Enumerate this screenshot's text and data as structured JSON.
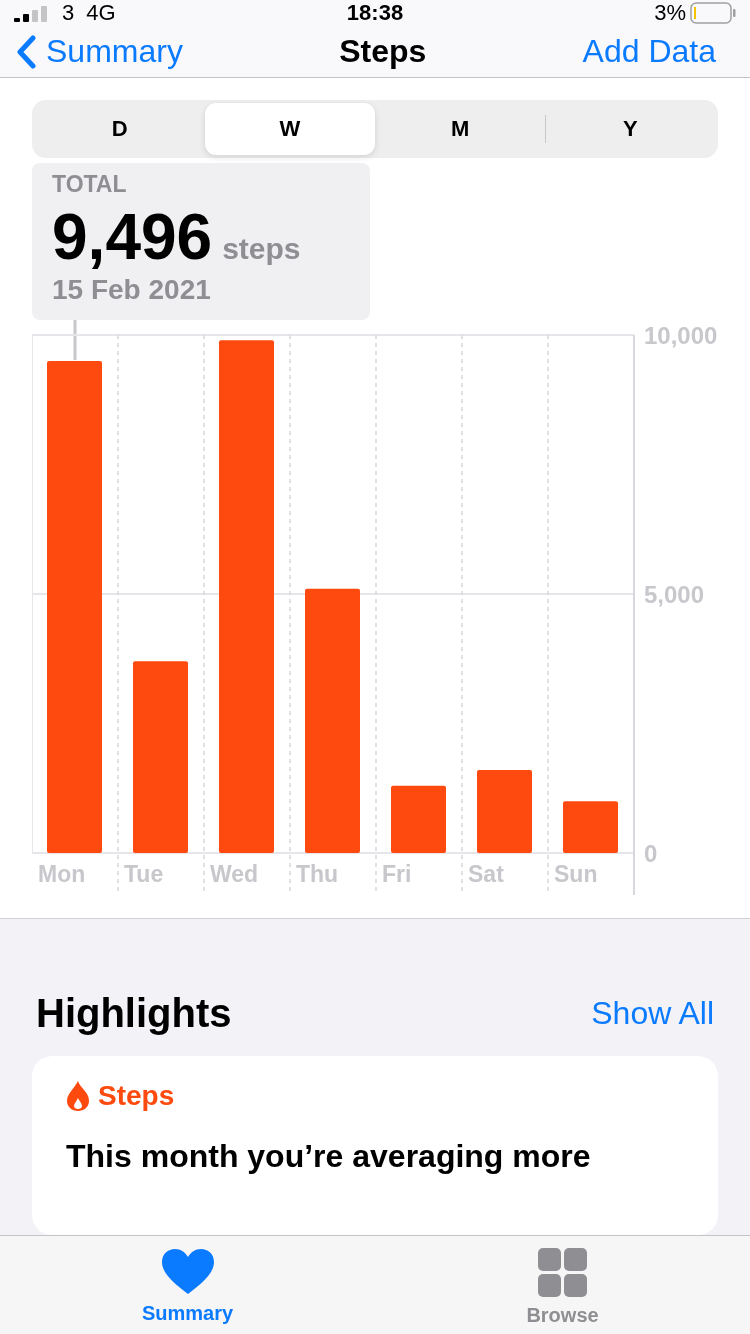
{
  "status_bar": {
    "carrier": "3",
    "network": "4G",
    "time": "18:38",
    "battery": "3%"
  },
  "nav": {
    "back": "Summary",
    "title": "Steps",
    "action": "Add Data"
  },
  "segments": [
    {
      "label": "D",
      "selected": false
    },
    {
      "label": "W",
      "selected": true
    },
    {
      "label": "M",
      "selected": false
    },
    {
      "label": "Y",
      "selected": false
    }
  ],
  "summary": {
    "label": "TOTAL",
    "value": "9,496",
    "unit": "steps",
    "date": "15 Feb 2021"
  },
  "chart_data": {
    "type": "bar",
    "categories": [
      "Mon",
      "Tue",
      "Wed",
      "Thu",
      "Fri",
      "Sat",
      "Sun"
    ],
    "series": [
      {
        "color": "#fe4a0e",
        "values": [
          9500,
          3700,
          9900,
          5100,
          1300,
          1600,
          1000
        ]
      }
    ],
    "ylim": [
      0,
      10000
    ],
    "yticks": [
      {
        "value": 0,
        "label": "0"
      },
      {
        "value": 5000,
        "label": "5,000"
      },
      {
        "value": 10000,
        "label": "10,000"
      }
    ]
  },
  "highlights": {
    "title": "Highlights",
    "action": "Show All",
    "card": {
      "category": "Steps",
      "text": "This month you’re averaging more"
    }
  },
  "tab_bar": [
    {
      "label": "Summary",
      "selected": true
    },
    {
      "label": "Browse",
      "selected": false
    }
  ]
}
